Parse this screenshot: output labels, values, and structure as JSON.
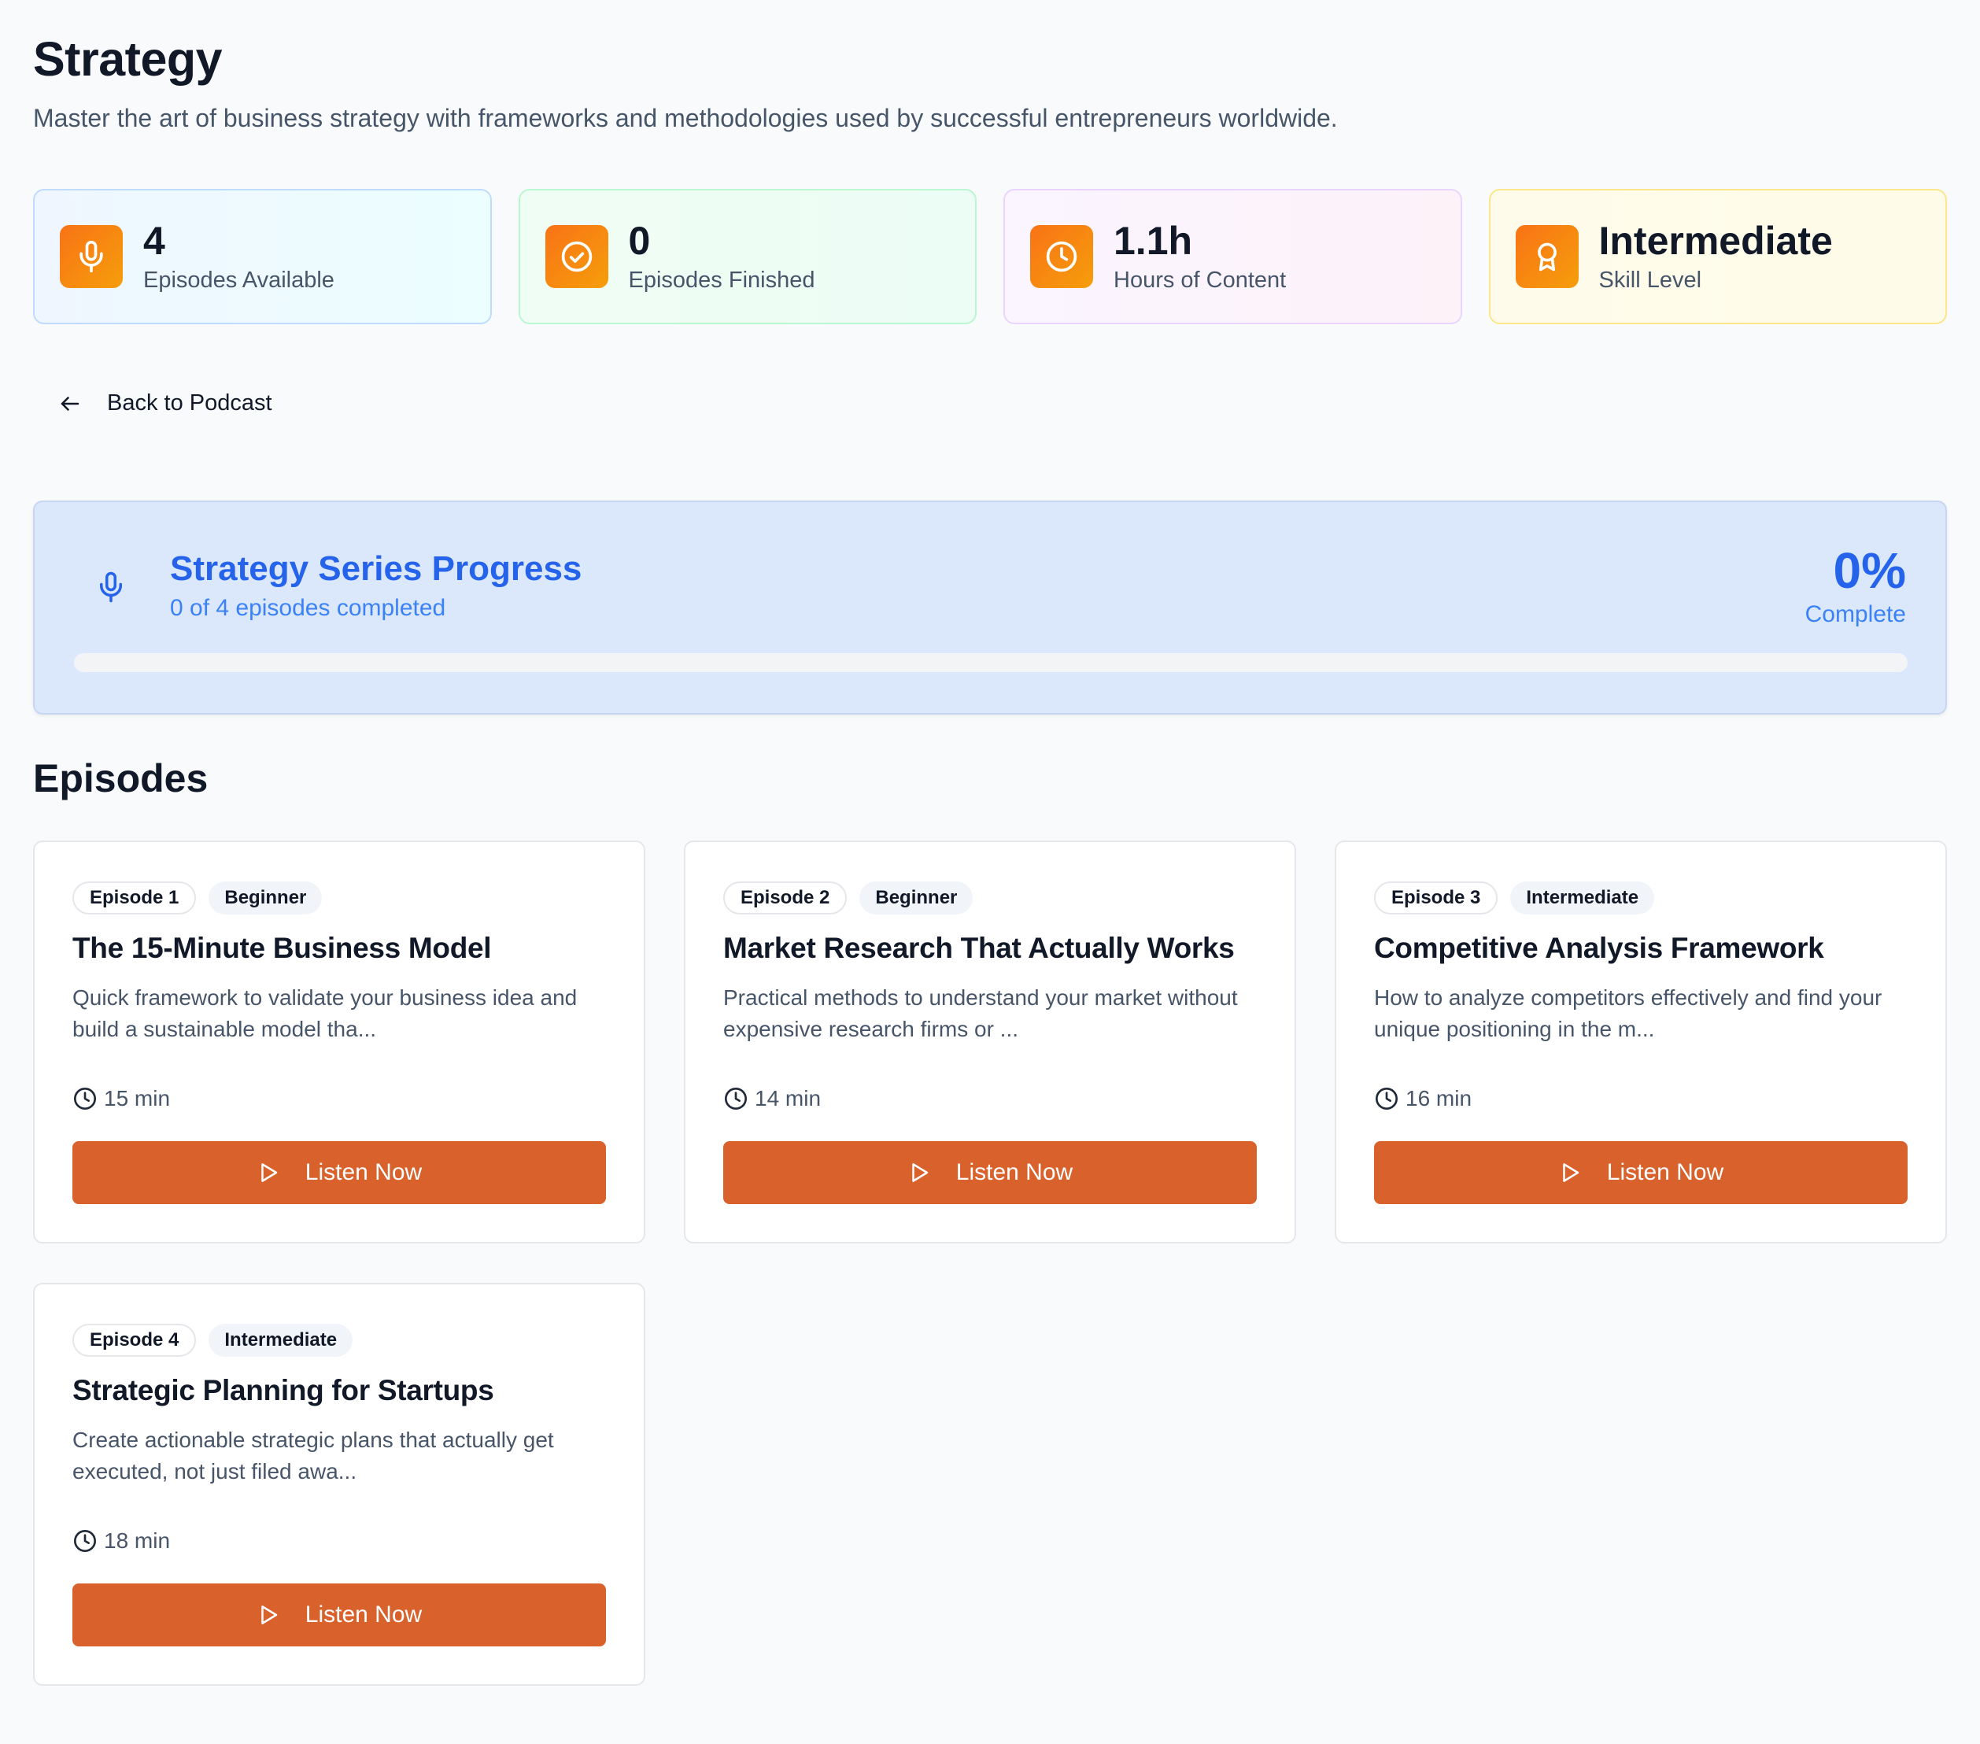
{
  "header": {
    "title": "Strategy",
    "subtitle": "Master the art of business strategy with frameworks and methodologies used by successful entrepreneurs worldwide."
  },
  "stats": [
    {
      "value": "4",
      "label": "Episodes Available",
      "icon": "microphone-icon"
    },
    {
      "value": "0",
      "label": "Episodes Finished",
      "icon": "check-circle-icon"
    },
    {
      "value": "1.1h",
      "label": "Hours of Content",
      "icon": "clock-icon"
    },
    {
      "value": "Intermediate",
      "label": "Skill Level",
      "icon": "award-icon"
    }
  ],
  "nav": {
    "back_label": "Back to Podcast"
  },
  "progress": {
    "title": "Strategy Series Progress",
    "subtitle": "0 of 4 episodes completed",
    "percent_label": "0%",
    "complete_label": "Complete",
    "fraction": 0
  },
  "episodes_section": {
    "title": "Episodes",
    "items": [
      {
        "number": "Episode 1",
        "level": "Beginner",
        "title": "The 15-Minute Business Model",
        "description": "Quick framework to validate your business idea and build a sustainable model tha...",
        "duration": "15 min",
        "cta": "Listen Now"
      },
      {
        "number": "Episode 2",
        "level": "Beginner",
        "title": "Market Research That Actually Works",
        "description": "Practical methods to understand your market without expensive research firms or ...",
        "duration": "14 min",
        "cta": "Listen Now"
      },
      {
        "number": "Episode 3",
        "level": "Intermediate",
        "title": "Competitive Analysis Framework",
        "description": "How to analyze competitors effectively and find your unique positioning in the m...",
        "duration": "16 min",
        "cta": "Listen Now"
      },
      {
        "number": "Episode 4",
        "level": "Intermediate",
        "title": "Strategic Planning for Startups",
        "description": "Create actionable strategic plans that actually get executed, not just filed awa...",
        "duration": "18 min",
        "cta": "Listen Now"
      }
    ]
  },
  "colors": {
    "accent_orange": "#d9612c",
    "progress_blue": "#2563eb"
  }
}
